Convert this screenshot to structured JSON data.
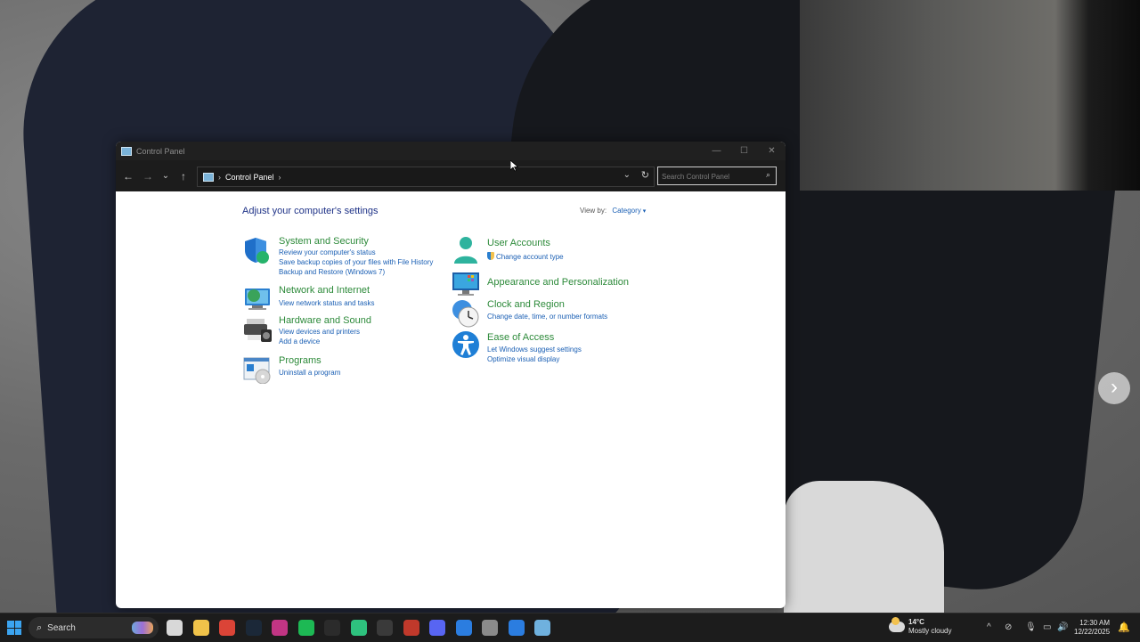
{
  "window": {
    "title": "Control Panel",
    "controls": {
      "minimize": "—",
      "maximize": "☐",
      "close": "✕"
    }
  },
  "address": {
    "back": "←",
    "forward": "→",
    "recent": "⌄",
    "up": "↑",
    "separator": "›",
    "path": "Control Panel",
    "dropdown": "⌄",
    "refresh": "↻"
  },
  "search": {
    "placeholder": "Search Control Panel",
    "icon": "⌕"
  },
  "main": {
    "heading": "Adjust your computer's settings",
    "view_by_label": "View by:",
    "view_by_value": "Category",
    "categories": [
      {
        "title": "System and Security",
        "icon": "shield-icon",
        "links": [
          "Review your computer's status",
          "Save backup copies of your files with File History",
          "Backup and Restore (Windows 7)"
        ]
      },
      {
        "title": "Network and Internet",
        "icon": "network-globe-icon",
        "links": [
          "View network status and tasks"
        ]
      },
      {
        "title": "Hardware and Sound",
        "icon": "printer-speaker-icon",
        "links": [
          "View devices and printers",
          "Add a device"
        ]
      },
      {
        "title": "Programs",
        "icon": "programs-disc-icon",
        "links": [
          "Uninstall a program"
        ]
      },
      {
        "title": "User Accounts",
        "icon": "user-icon",
        "links": [
          "Change account type"
        ]
      },
      {
        "title": "Appearance and Personalization",
        "icon": "monitor-palette-icon",
        "links": []
      },
      {
        "title": "Clock and Region",
        "icon": "clock-globe-icon",
        "links": [
          "Change date, time, or number formats"
        ]
      },
      {
        "title": "Ease of Access",
        "icon": "accessibility-icon",
        "links": [
          "Let Windows suggest settings",
          "Optimize visual display"
        ]
      }
    ]
  },
  "taskbar": {
    "search_label": "Search",
    "weather_temp": "14°C",
    "weather_desc": "Mostly cloudy",
    "time": "12:30 AM",
    "date": "12/22/2025",
    "apps": [
      {
        "name": "task-view",
        "color": "#d8d8d8"
      },
      {
        "name": "file-explorer",
        "color": "#f0c34a"
      },
      {
        "name": "chrome",
        "color": "#db4437"
      },
      {
        "name": "steam",
        "color": "#1b2838"
      },
      {
        "name": "instagram",
        "color": "#c13584"
      },
      {
        "name": "spotify",
        "color": "#1db954"
      },
      {
        "name": "terminal",
        "color": "#2b2b2b"
      },
      {
        "name": "app-green",
        "color": "#2ec27e"
      },
      {
        "name": "obs",
        "color": "#3a3a3a"
      },
      {
        "name": "voicemeeter",
        "color": "#c0392b"
      },
      {
        "name": "discord",
        "color": "#5865f2"
      },
      {
        "name": "mail",
        "color": "#2b7de0"
      },
      {
        "name": "settings",
        "color": "#8a8a8a"
      },
      {
        "name": "defender",
        "color": "#2b7de0"
      },
      {
        "name": "control-panel",
        "color": "#6fb1de"
      }
    ]
  },
  "colors": {
    "category_title": "#2d8a3a",
    "link": "#1a5fb4",
    "heading": "#1e3287",
    "titlebar": "#202020",
    "taskbar": "#1c1c1c"
  }
}
